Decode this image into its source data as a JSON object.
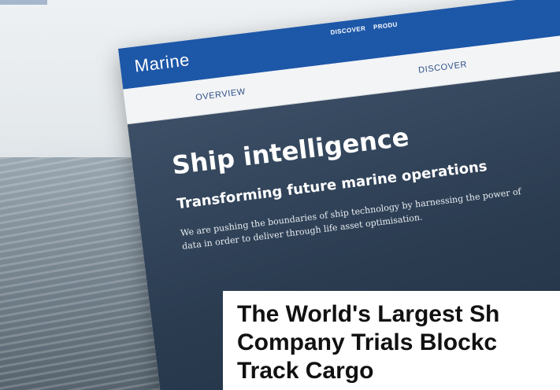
{
  "site": {
    "brand": "Marine",
    "top_nav": [
      "DISCOVER",
      "PRODU"
    ],
    "sub_nav": {
      "overview": "OVERVIEW",
      "discover": "DISCOVER"
    }
  },
  "hero": {
    "title": "Ship intelligence",
    "subtitle": "Transforming future marine operations",
    "body": "We are pushing the boundaries of ship technology by harnessing the power of data in order to deliver through life asset optimisation."
  },
  "headline": {
    "line1": "The World's Largest Sh",
    "line2": "Company Trials Blockc",
    "line3": "Track Cargo"
  }
}
